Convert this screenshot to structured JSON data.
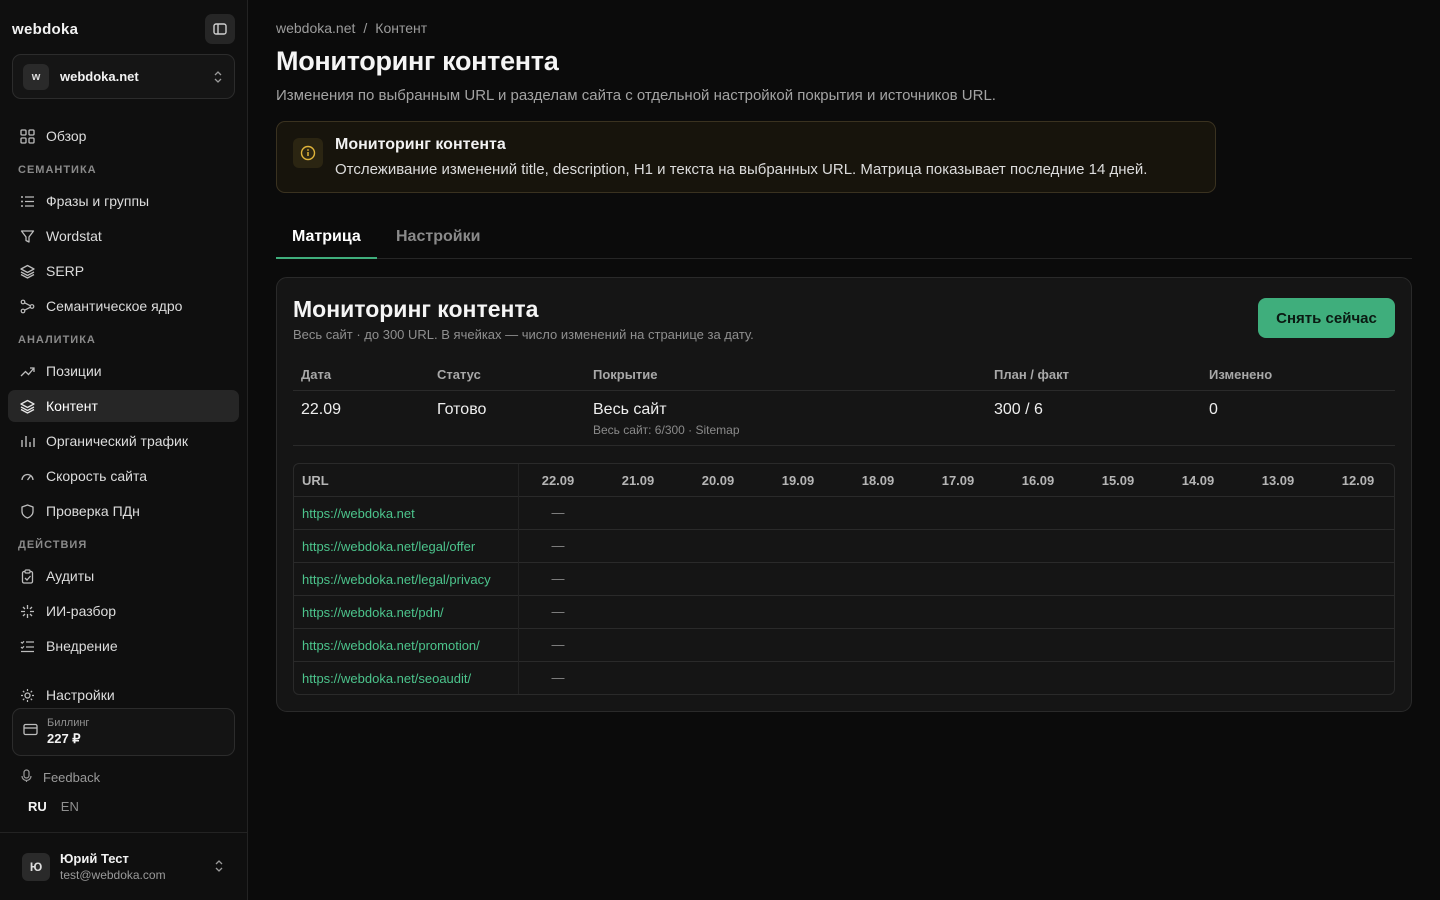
{
  "brand": "webdoka",
  "site": {
    "avatar": "w",
    "name": "webdoka.net"
  },
  "nav": {
    "overview": "Обзор",
    "section_semantics": "СЕМАНТИКА",
    "phrases": "Фразы и группы",
    "wordstat": "Wordstat",
    "serp": "SERP",
    "core": "Семантическое ядро",
    "section_analytics": "АНАЛИТИКА",
    "positions": "Позиции",
    "content": "Контент",
    "traffic": "Органический трафик",
    "speed": "Скорость сайта",
    "pdn": "Проверка ПДн",
    "section_actions": "ДЕЙСТВИЯ",
    "audits": "Аудиты",
    "ai": "ИИ-разбор",
    "implementation": "Внедрение",
    "settings": "Настройки"
  },
  "billing": {
    "label": "Биллинг",
    "value": "227 ₽"
  },
  "feedback": "Feedback",
  "langs": {
    "ru": "RU",
    "en": "EN"
  },
  "user": {
    "initial": "Ю",
    "name": "Юрий Тест",
    "email": "test@webdoka.com"
  },
  "breadcrumb": {
    "root": "webdoka.net",
    "sep": "/",
    "current": "Контент"
  },
  "page": {
    "title": "Мониторинг контента",
    "subtitle": "Изменения по выбранным URL и разделам сайта с отдельной настройкой покрытия и источников URL."
  },
  "alert": {
    "title": "Мониторинг контента",
    "text": "Отслеживание изменений title, description, H1 и текста на выбранных URL. Матрица показывает последние 14 дней."
  },
  "tabs": {
    "matrix": "Матрица",
    "settings": "Настройки"
  },
  "card": {
    "title": "Мониторинг контента",
    "subtitle": "Весь сайт · до 300 URL. В ячейках — число изменений на странице за дату.",
    "snapshot_button": "Снять сейчас"
  },
  "summary": {
    "headers": {
      "date": "Дата",
      "status": "Статус",
      "coverage": "Покрытие",
      "plan": "План / факт",
      "changed": "Изменено"
    },
    "row": {
      "date": "22.09",
      "status": "Готово",
      "coverage": "Весь сайт",
      "coverage_sub": "Весь сайт: 6/300 · Sitemap",
      "plan": "300 / 6",
      "changed": "0"
    }
  },
  "matrix": {
    "url_header": "URL",
    "dates": [
      "22.09",
      "21.09",
      "20.09",
      "19.09",
      "18.09",
      "17.09",
      "16.09",
      "15.09",
      "14.09",
      "13.09",
      "12.09"
    ],
    "rows": [
      {
        "url": "https://webdoka.net",
        "first": "—"
      },
      {
        "url": "https://webdoka.net/legal/offer",
        "first": "—"
      },
      {
        "url": "https://webdoka.net/legal/privacy",
        "first": "—"
      },
      {
        "url": "https://webdoka.net/pdn/",
        "first": "—"
      },
      {
        "url": "https://webdoka.net/promotion/",
        "first": "—"
      },
      {
        "url": "https://webdoka.net/seoaudit/",
        "first": "—"
      }
    ]
  },
  "colors": {
    "accent": "#3fae7c",
    "link": "#4cc48c",
    "alert_bg": "#17140c",
    "alert_icon": "#e0b43a"
  }
}
